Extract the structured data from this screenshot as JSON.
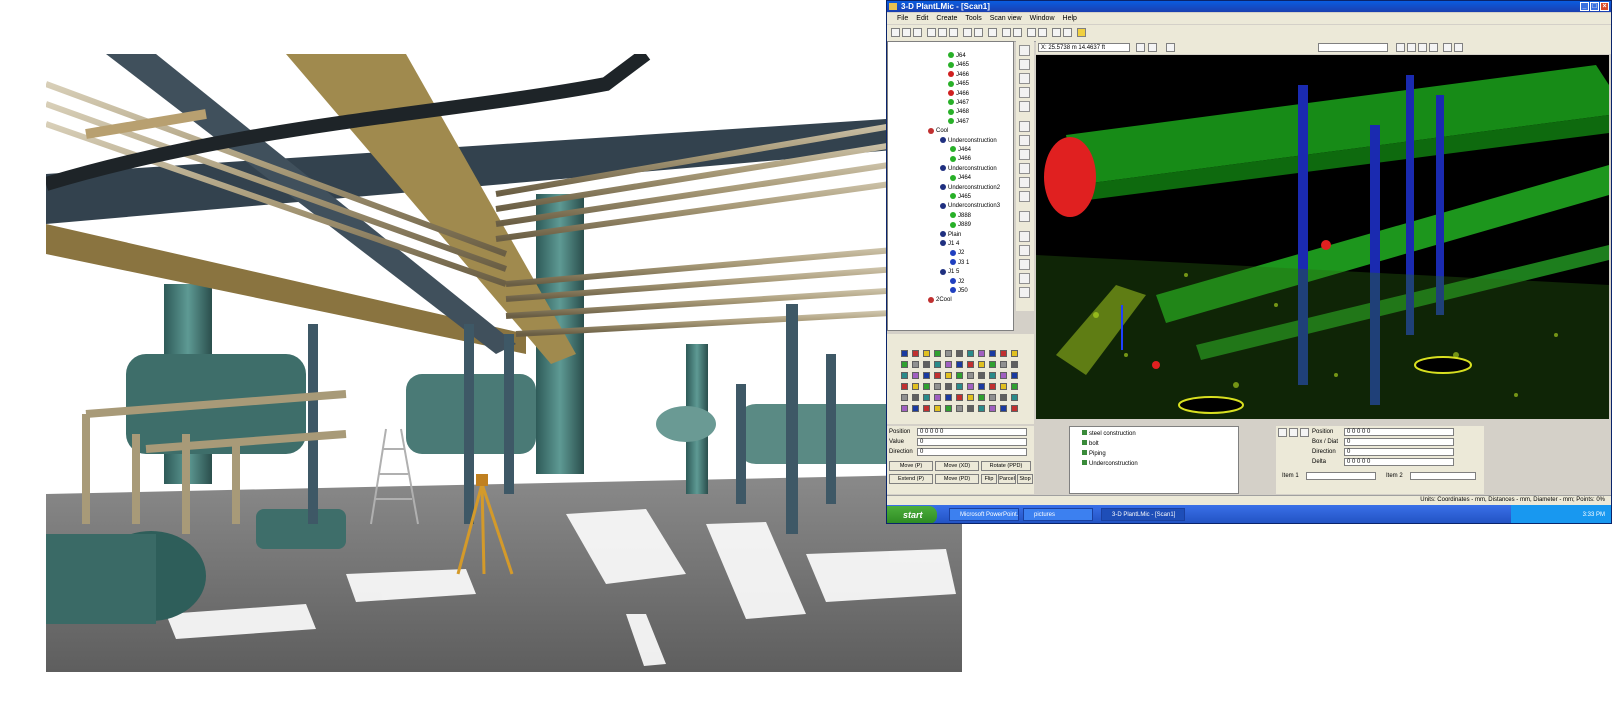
{
  "app": {
    "title": "3-D PlantLMic - [Scan1]",
    "menu": [
      "File",
      "Edit",
      "Create",
      "Tools",
      "Scan view",
      "Window",
      "Help"
    ],
    "coords_readout": "X: 25.5738 m 14.4637 ft"
  },
  "tree": [
    {
      "label": "J64",
      "color": "#28b028"
    },
    {
      "label": "J465",
      "color": "#28b028"
    },
    {
      "label": "J466",
      "color": "#d02020"
    },
    {
      "label": "J465",
      "color": "#28b028"
    },
    {
      "label": "J466",
      "color": "#d02020"
    },
    {
      "label": "J467",
      "color": "#28b028"
    },
    {
      "label": "J468",
      "color": "#28b028"
    },
    {
      "label": "J467",
      "color": "#28b028"
    },
    {
      "label": "Cool",
      "color": "#c03030"
    },
    {
      "label": "Underconstruction",
      "color": "#203080"
    },
    {
      "label": "J464",
      "color": "#28b028"
    },
    {
      "label": "J466",
      "color": "#28b028"
    },
    {
      "label": "Underconstruction",
      "color": "#203080"
    },
    {
      "label": "J464",
      "color": "#28b028"
    },
    {
      "label": "Underconstruction2",
      "color": "#203080"
    },
    {
      "label": "J465",
      "color": "#28b028"
    },
    {
      "label": "Underconstruction3",
      "color": "#203080"
    },
    {
      "label": "J888",
      "color": "#28b028"
    },
    {
      "label": "J889",
      "color": "#28b028"
    },
    {
      "label": "Plain",
      "color": "#203080"
    },
    {
      "label": "J1 4",
      "color": "#203080"
    },
    {
      "label": "J2",
      "color": "#2040c0"
    },
    {
      "label": "J3 1",
      "color": "#2040c0"
    },
    {
      "label": "J1 5",
      "color": "#203080"
    },
    {
      "label": "J2",
      "color": "#2040c0"
    },
    {
      "label": "J50",
      "color": "#2040c0"
    },
    {
      "label": "2Cool",
      "color": "#c03030"
    }
  ],
  "properties": {
    "position_label": "Position",
    "position_value": "0 0 0 0 0",
    "value_label": "Value",
    "value_value": "0",
    "direction_label": "Direction",
    "direction_value": "0",
    "buttons": [
      "Move (P)",
      "Move (XD)",
      "Rotate (PPD)",
      "Extend (P)",
      "Move (PD)",
      "Flip",
      "Parcel",
      "Stop"
    ]
  },
  "layers": [
    "steel construction",
    "bolt",
    "Piping",
    "Underconstruction"
  ],
  "right_props": {
    "rows": [
      {
        "label": "Position",
        "value": "0 0 0 0 0"
      },
      {
        "label": "Box / Diat",
        "value": "0"
      },
      {
        "label": "Direction",
        "value": "0"
      },
      {
        "label": "Delta",
        "value": "0 0 0 0 0"
      }
    ],
    "item1": "Item 1",
    "item2": "Item 2"
  },
  "status": "Units: Coordinates - mm, Distances - mm, Diameter - mm; Points: 0%",
  "taskbar": {
    "start": "start",
    "tasks": [
      "Microsoft PowerPoint...",
      "pictures",
      "3-D PlantLMic - [Scan1]"
    ],
    "clock": "3:33 PM"
  }
}
